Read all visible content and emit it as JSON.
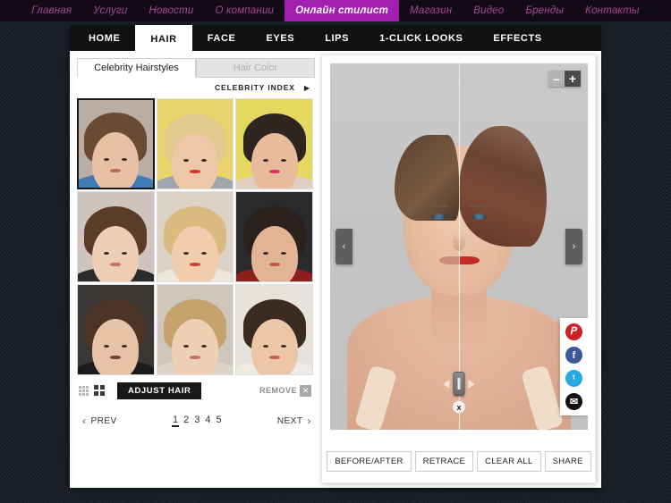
{
  "site_nav": {
    "items": [
      {
        "label": "Главная",
        "active": false
      },
      {
        "label": "Услуги",
        "active": false
      },
      {
        "label": "Новости",
        "active": false
      },
      {
        "label": "О компании",
        "active": false
      },
      {
        "label": "Онлайн стилист",
        "active": true
      },
      {
        "label": "Магазин",
        "active": false
      },
      {
        "label": "Видео",
        "active": false
      },
      {
        "label": "Бренды",
        "active": false
      },
      {
        "label": "Контакты",
        "active": false
      }
    ],
    "accent_color": "#a31fb0",
    "link_color": "#a8479c"
  },
  "app_tabs": [
    {
      "label": "HOME",
      "active": false
    },
    {
      "label": "HAIR",
      "active": true
    },
    {
      "label": "FACE",
      "active": false
    },
    {
      "label": "EYES",
      "active": false
    },
    {
      "label": "LIPS",
      "active": false
    },
    {
      "label": "1-CLICK LOOKS",
      "active": false
    },
    {
      "label": "EFFECTS",
      "active": false
    }
  ],
  "left_panel": {
    "sub_tabs": [
      {
        "label": "Celebrity Hairstyles",
        "active": true
      },
      {
        "label": "Hair Color",
        "active": false
      }
    ],
    "celebrity_index": {
      "label": "CELEBRITY INDEX",
      "arrow": "▶"
    },
    "thumbnails": [
      {
        "name": "short-pixie-brunette",
        "selected": true,
        "bg": "#b9ada4",
        "hair": "#6a4a33",
        "skin": "#e8c0a6",
        "mouth": "#bd6a5e",
        "cloth": "#3f7cb5"
      },
      {
        "name": "blonde-headband",
        "selected": false,
        "bg": "#e8d46a",
        "hair": "#e2c98e",
        "skin": "#eec7a8",
        "mouth": "#d6362c",
        "cloth": "#9fa6ae"
      },
      {
        "name": "dark-bangs-bob",
        "selected": false,
        "bg": "#e4d95e",
        "hair": "#2e2420",
        "skin": "#e7bb9c",
        "mouth": "#cf3a5e",
        "cloth": "#e0cfc0"
      },
      {
        "name": "brunette-updo",
        "selected": false,
        "bg": "#cfc4bd",
        "hair": "#5a3c29",
        "skin": "#edcdb4",
        "mouth": "#c6735f",
        "cloth": "#2b2b2b"
      },
      {
        "name": "long-blonde-wavy",
        "selected": false,
        "bg": "#ddd2c6",
        "hair": "#d9ba7f",
        "skin": "#f0cdad",
        "mouth": "#c9433c",
        "cloth": "#efe6da"
      },
      {
        "name": "dark-wavy-side",
        "selected": false,
        "bg": "#2a2a2c",
        "hair": "#2b211c",
        "skin": "#e2b493",
        "mouth": "#c0564d",
        "cloth": "#8e1f1f"
      },
      {
        "name": "brunette-side-sweep",
        "selected": false,
        "bg": "#3a3734",
        "hair": "#4b3326",
        "skin": "#e6c2a7",
        "mouth": "#7d3f3d",
        "cloth": "#1d1b1a"
      },
      {
        "name": "blonde-straight-long",
        "selected": false,
        "bg": "#cfc7bc",
        "hair": "#c6a36c",
        "skin": "#f0d0b4",
        "mouth": "#c2746a",
        "cloth": "#ded5c9"
      },
      {
        "name": "dark-long-layers",
        "selected": false,
        "bg": "#e6e2dc",
        "hair": "#3a2a22",
        "skin": "#edc6a8",
        "mouth": "#c2615a",
        "cloth": "#efeae3"
      }
    ],
    "toolbar": {
      "grid_small_icon": "grid-small-icon",
      "grid_large_icon": "grid-large-icon",
      "adjust_hair_label": "ADJUST HAIR",
      "remove_label": "REMOVE",
      "remove_icon": "close-x-icon"
    },
    "pagination": {
      "prev_label": "PREV",
      "next_label": "NEXT",
      "prev_chevron": "‹",
      "next_chevron": "›",
      "pages": [
        "1",
        "2",
        "3",
        "4",
        "5"
      ],
      "current_page": "1"
    }
  },
  "viewer": {
    "zoom_out_label": "–",
    "zoom_in_label": "+",
    "prev_arrow": "‹",
    "next_arrow": "›",
    "slider": {
      "left_arrow_icon": "triangle-left-icon",
      "right_arrow_icon": "triangle-right-icon",
      "handle_icon": "split-slider-handle",
      "close_label": "x"
    },
    "social": [
      {
        "name": "pinterest",
        "glyph": "𝑃",
        "color": "#cb2027"
      },
      {
        "name": "facebook",
        "glyph": "f",
        "color": "#3b5998"
      },
      {
        "name": "twitter",
        "glyph": "ᵗ",
        "color": "#29a9e0"
      },
      {
        "name": "email",
        "glyph": "✉",
        "color": "#111111"
      }
    ],
    "actions": [
      {
        "label": "BEFORE/AFTER"
      },
      {
        "label": "RETRACE"
      },
      {
        "label": "CLEAR ALL"
      },
      {
        "label": "SHARE"
      }
    ]
  }
}
